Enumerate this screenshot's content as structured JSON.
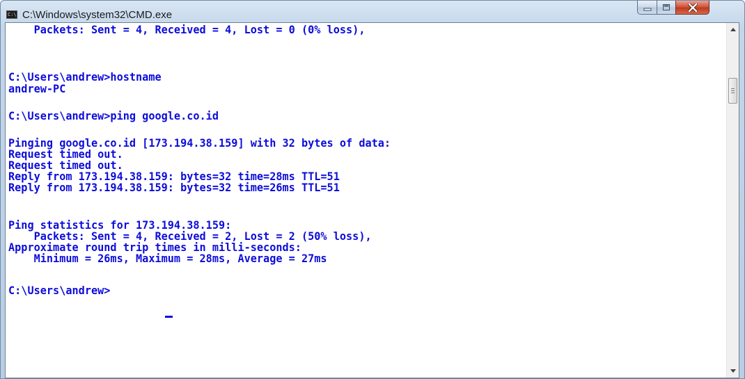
{
  "window": {
    "title": "C:\\Windows\\system32\\CMD.exe",
    "app_icon_text": "C:\\"
  },
  "controls": {
    "minimize_icon": "minimize-icon",
    "maximize_icon": "maximize-icon",
    "close_icon": "close-icon"
  },
  "console": {
    "text_color": "#0d0ddb",
    "background": "#ffffff",
    "lines": [
      "    Packets: Sent = 4, Received = 4, Lost = 0 (0% loss),",
      "",
      "C:\\Users\\andrew>hostname",
      "andrew-PC",
      "",
      "C:\\Users\\andrew>ping google.co.id",
      "",
      "Pinging google.co.id [173.194.38.159] with 32 bytes of data:",
      "Request timed out.",
      "Request timed out.",
      "Reply from 173.194.38.159: bytes=32 time=28ms TTL=51",
      "Reply from 173.194.38.159: bytes=32 time=26ms TTL=51",
      "",
      "Ping statistics for 173.194.38.159:",
      "    Packets: Sent = 4, Received = 2, Lost = 2 (50% loss),",
      "Approximate round trip times in milli-seconds:",
      "    Minimum = 26ms, Maximum = 28ms, Average = 27ms",
      "",
      "C:\\Users\\andrew>"
    ]
  },
  "scrollbar": {
    "up_icon": "scroll-up-arrow-icon",
    "down_icon": "scroll-down-arrow-icon"
  }
}
